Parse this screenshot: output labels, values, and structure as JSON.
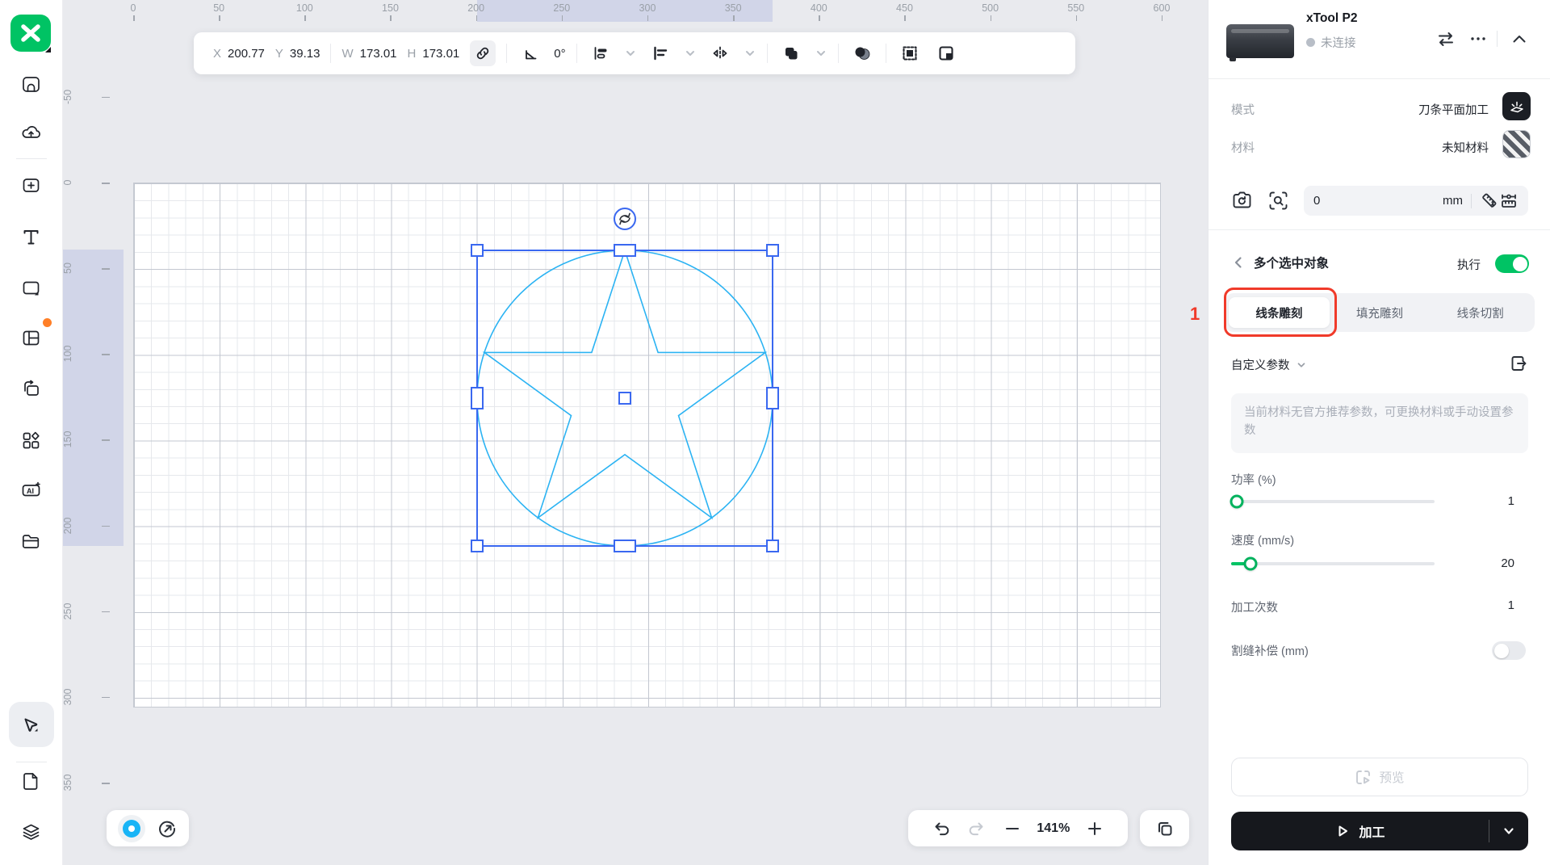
{
  "toolbar": {
    "x_label": "X",
    "x_value": "200.77",
    "y_label": "Y",
    "y_value": "39.13",
    "w_label": "W",
    "w_value": "173.01",
    "h_label": "H",
    "h_value": "173.01",
    "angle_value": "0°"
  },
  "rulers": {
    "h_ticks": [
      0,
      50,
      100,
      150,
      200,
      250,
      300,
      350,
      400,
      450,
      500,
      550,
      600
    ],
    "v_ticks": [
      -50,
      0,
      50,
      100,
      150,
      200,
      250,
      300,
      350
    ]
  },
  "statusbar": {
    "zoom_value": "141%"
  },
  "device": {
    "name": "xTool P2",
    "status": "未连接",
    "mode_label": "模式",
    "mode_value": "刀条平面加工",
    "material_label": "材料",
    "material_value": "未知材料",
    "distance_value": "0",
    "distance_unit": "mm"
  },
  "selection_panel": {
    "title": "多个选中对象",
    "execute_label": "执行",
    "tabs": [
      "线条雕刻",
      "填充雕刻",
      "线条切割"
    ],
    "active_tab": "线条雕刻",
    "annotation_number": "1",
    "custom_params_label": "自定义参数",
    "warning_text": "当前材料无官方推荐参数，可更换材料或手动设置参数",
    "power_label": "功率 (%)",
    "power_value": "1",
    "speed_label": "速度 (mm/s)",
    "speed_value": "20",
    "passes_label": "加工次数",
    "passes_value": "1",
    "kerf_label": "割缝补偿 (mm)",
    "preview_label": "预览",
    "process_label": "加工"
  },
  "icons": {
    "ai_label": "AI"
  },
  "colors": {
    "brand_green": "#00c364",
    "selection_blue": "#3a68f0",
    "shape_cyan": "#2bb3f3",
    "annotation_red": "#f03a2a",
    "position_dot_blue": "#18b4f6",
    "notification_orange": "#ff7f27"
  }
}
